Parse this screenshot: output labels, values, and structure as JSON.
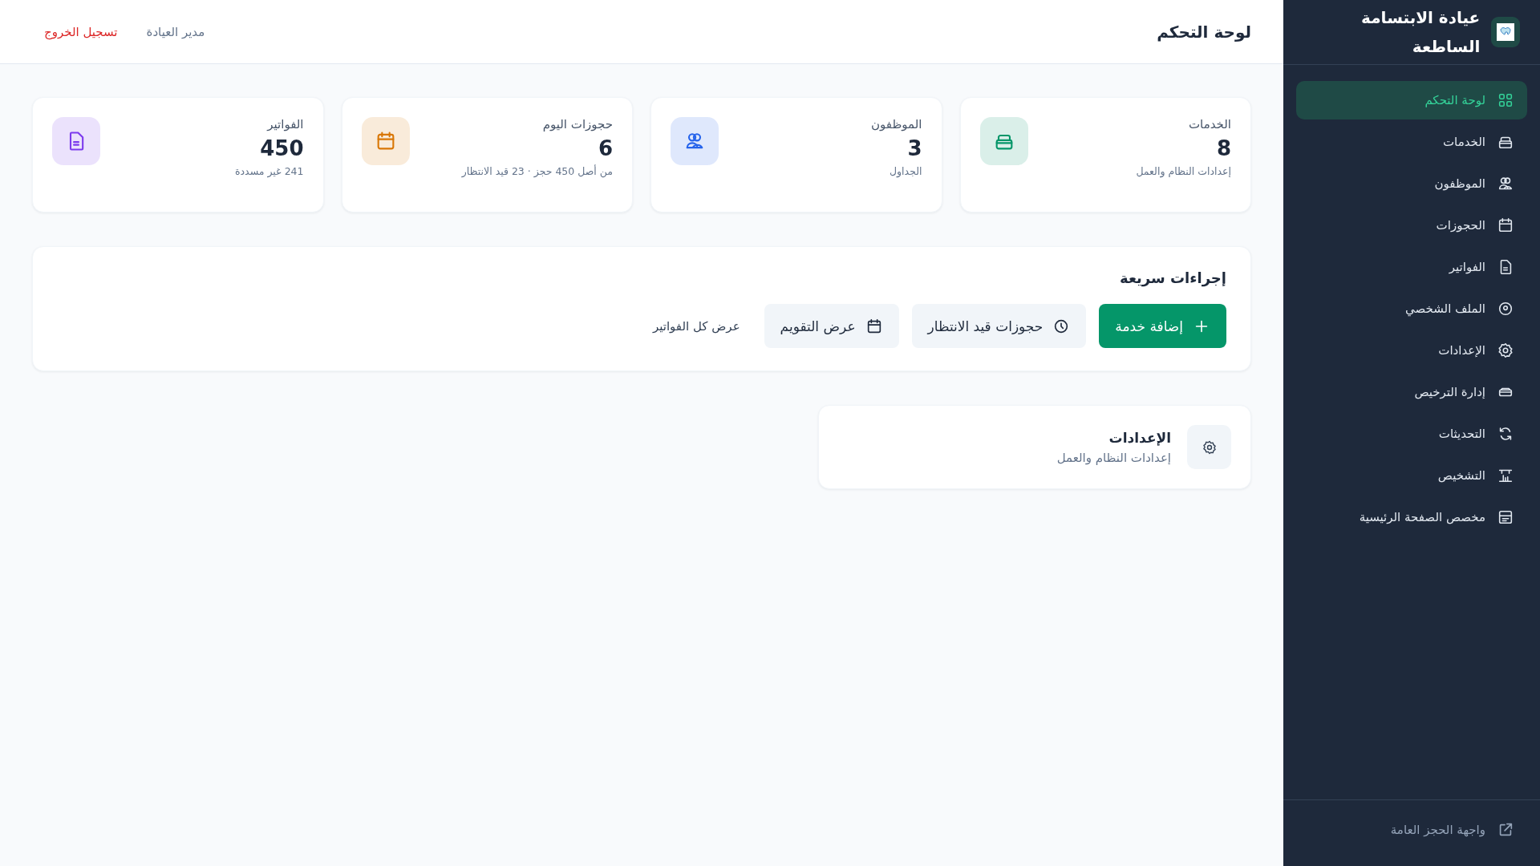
{
  "header": {
    "title": "لوحة التحكم",
    "user": "مدير العيادة",
    "logout": "تسجيل الخروج"
  },
  "sidebar": {
    "brand": "عيادة الابتسامة الساطعة",
    "items": [
      {
        "label": "لوحة التحكم",
        "selected": true
      },
      {
        "label": "الخدمات",
        "selected": false
      },
      {
        "label": "الموظفون",
        "selected": false
      },
      {
        "label": "الحجوزات",
        "selected": false
      },
      {
        "label": "الفواتير",
        "selected": false
      },
      {
        "label": "الملف الشخصي",
        "selected": false
      },
      {
        "label": "الإعدادات",
        "selected": false
      },
      {
        "label": "إدارة الترخيص",
        "selected": false
      },
      {
        "label": "التحديثات",
        "selected": false
      },
      {
        "label": "التشخيص",
        "selected": false
      },
      {
        "label": "مخصص الصفحة الرئيسية",
        "selected": false
      }
    ],
    "footer_link": "واجهة الحجز العامة"
  },
  "stats": [
    {
      "label": "الخدمات",
      "value": "8",
      "note": "إعدادات النظام والعمل",
      "color": "#059669"
    },
    {
      "label": "الموظفون",
      "value": "3",
      "note": "الجداول",
      "color": "#2563eb"
    },
    {
      "label": "حجوزات اليوم",
      "value": "6",
      "note": "من أصل 450 حجز · 23 قيد الانتظار",
      "color": "#d97706"
    },
    {
      "label": "الفواتير",
      "value": "450",
      "note": "241 غير مسددة",
      "color": "#7c3aed"
    }
  ],
  "quick_actions": {
    "title": "إجراءات سريعة",
    "buttons": [
      {
        "label": "إضافة خدمة",
        "kind": "primary"
      },
      {
        "label": "حجوزات قيد الانتظار",
        "kind": "secondary"
      },
      {
        "label": "عرض التقويم",
        "kind": "secondary"
      },
      {
        "label": "عرض كل الفواتير",
        "kind": "link"
      }
    ]
  },
  "settings_card": {
    "title": "الإعدادات",
    "subtitle": "إعدادات النظام والعمل"
  }
}
